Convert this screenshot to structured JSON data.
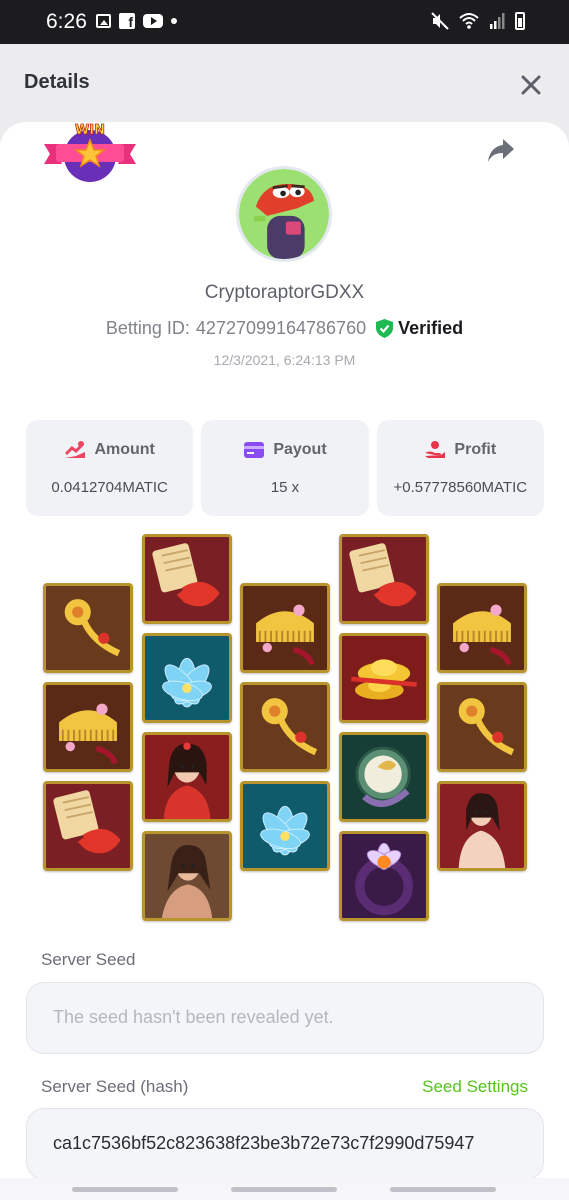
{
  "status_bar": {
    "time": "6:26",
    "left_icons": [
      "gallery-icon",
      "facebook-icon",
      "youtube-icon",
      "dot-icon"
    ],
    "right_icons": [
      "mute-icon",
      "wifi-icon",
      "signal-icon",
      "battery-icon"
    ]
  },
  "header": {
    "title": "Details",
    "close_icon": "close-icon"
  },
  "badge": {
    "text": "WIN"
  },
  "user": {
    "name": "CryptoraptorGDXX",
    "betting_id_label": "Betting ID:",
    "betting_id": "42727099164786760",
    "verified_label": "Verified",
    "date": "12/3/2021, 6:24:13 PM"
  },
  "stats": [
    {
      "label": "Amount",
      "value": "0.0412704MATIC",
      "icon": "amount-icon"
    },
    {
      "label": "Payout",
      "value": "15 x",
      "icon": "card-icon"
    },
    {
      "label": "Profit",
      "value": "+0.57778560MATIC",
      "icon": "profit-icon"
    }
  ],
  "reels": [
    [
      "golden-hairpin",
      "golden-comb",
      "scroll-koi"
    ],
    [
      "scroll-koi",
      "blue-lotus",
      "lady-red",
      "lady-brown"
    ],
    [
      "golden-comb",
      "golden-hairpin",
      "blue-lotus"
    ],
    [
      "scroll-koi",
      "gold-ingots",
      "jade-mirror",
      "purple-ring"
    ],
    [
      "golden-comb",
      "golden-hairpin",
      "lady-pale"
    ]
  ],
  "server_seed": {
    "label": "Server Seed",
    "placeholder": "The seed hasn't been revealed yet."
  },
  "server_seed_hash": {
    "label": "Server Seed (hash)",
    "link": "Seed Settings",
    "value": "ca1c7536bf52c823638f23be3b72e73c7f2990d75947"
  },
  "colors": {
    "accent_green": "#56c21b",
    "verified_green": "#1fb954",
    "tile_border": "#b8952c"
  }
}
